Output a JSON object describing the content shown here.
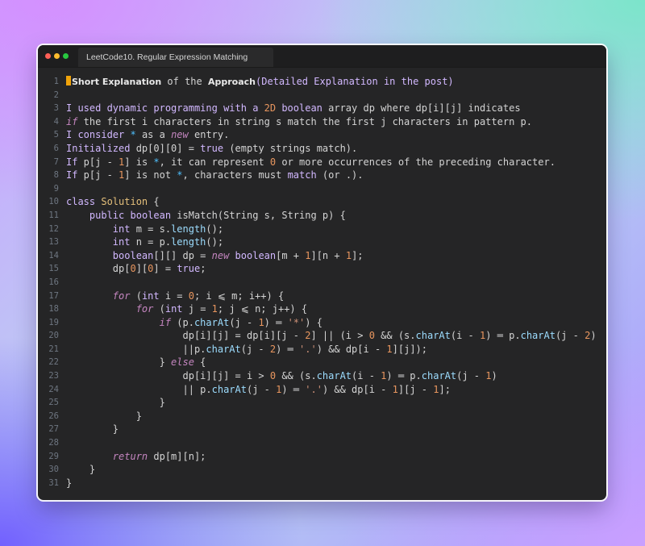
{
  "window": {
    "tab_title": "LeetCode10. Regular Expression Matching",
    "traffic_lights": [
      "#ff5f57",
      "#febc2e",
      "#28c840"
    ]
  },
  "editor": {
    "line_numbers": [
      "1",
      "2",
      "3",
      "4",
      "5",
      "6",
      "7",
      "8",
      "9",
      "10",
      "11",
      "12",
      "13",
      "14",
      "15",
      "16",
      "17",
      "18",
      "19",
      "20",
      "21",
      "22",
      "23",
      "24",
      "25",
      "26",
      "27",
      "28",
      "29",
      "30",
      "31"
    ],
    "lines": [
      [
        {
          "t": "Short Explanation",
          "c": "b"
        },
        {
          "t": " of the ",
          "c": ""
        },
        {
          "t": "Approach",
          "c": "b"
        },
        {
          "t": "(",
          "c": "c-f"
        },
        {
          "t": "Detailed Explanation",
          "c": "c-f"
        },
        {
          "t": " in the post)",
          "c": "c-f"
        }
      ],
      [],
      [
        {
          "t": "I used dynamic programming with a ",
          "c": "c-f"
        },
        {
          "t": "2D",
          "c": "c-n"
        },
        {
          "t": " ",
          "c": ""
        },
        {
          "t": "boolean",
          "c": "c-f"
        },
        {
          "t": " array dp where dp[i][j] indicates",
          "c": ""
        }
      ],
      [
        {
          "t": "if",
          "c": "c-i"
        },
        {
          "t": " the first i characters in string s match the first j characters in pattern p.",
          "c": ""
        }
      ],
      [
        {
          "t": "I consider ",
          "c": "c-f"
        },
        {
          "t": "*",
          "c": "c-b"
        },
        {
          "t": " as a ",
          "c": ""
        },
        {
          "t": "new",
          "c": "c-i"
        },
        {
          "t": " entry.",
          "c": ""
        }
      ],
      [
        {
          "t": "Initialized ",
          "c": "c-f"
        },
        {
          "t": "dp[0][0] = ",
          "c": ""
        },
        {
          "t": "true",
          "c": "c-f"
        },
        {
          "t": " (empty strings match).",
          "c": ""
        }
      ],
      [
        {
          "t": "If",
          "c": "c-f"
        },
        {
          "t": " p[j - ",
          "c": ""
        },
        {
          "t": "1",
          "c": "c-n"
        },
        {
          "t": "] is ",
          "c": ""
        },
        {
          "t": "*",
          "c": "c-b"
        },
        {
          "t": ", it can represent ",
          "c": ""
        },
        {
          "t": "0",
          "c": "c-n"
        },
        {
          "t": " or more occurrences of the preceding character.",
          "c": ""
        }
      ],
      [
        {
          "t": "If",
          "c": "c-f"
        },
        {
          "t": " p[j - ",
          "c": ""
        },
        {
          "t": "1",
          "c": "c-n"
        },
        {
          "t": "] is not ",
          "c": ""
        },
        {
          "t": "*",
          "c": "c-b"
        },
        {
          "t": ", characters must ",
          "c": ""
        },
        {
          "t": "match",
          "c": "c-f"
        },
        {
          "t": " (or .).",
          "c": ""
        }
      ],
      [],
      [
        {
          "t": "class",
          "c": "c-f"
        },
        {
          "t": " ",
          "c": ""
        },
        {
          "t": "Solution",
          "c": "c-y"
        },
        {
          "t": " {",
          "c": ""
        }
      ],
      [
        {
          "t": "    ",
          "c": ""
        },
        {
          "t": "public",
          "c": "c-f"
        },
        {
          "t": " ",
          "c": ""
        },
        {
          "t": "boolean",
          "c": "c-f"
        },
        {
          "t": " isMatch(String s, String p) {",
          "c": ""
        }
      ],
      [
        {
          "t": "        ",
          "c": ""
        },
        {
          "t": "int",
          "c": "c-f"
        },
        {
          "t": " m = s.",
          "c": ""
        },
        {
          "t": "length",
          "c": "c-m"
        },
        {
          "t": "();",
          "c": ""
        }
      ],
      [
        {
          "t": "        ",
          "c": ""
        },
        {
          "t": "int",
          "c": "c-f"
        },
        {
          "t": " n = p.",
          "c": ""
        },
        {
          "t": "length",
          "c": "c-m"
        },
        {
          "t": "();",
          "c": ""
        }
      ],
      [
        {
          "t": "        ",
          "c": ""
        },
        {
          "t": "boolean",
          "c": "c-f"
        },
        {
          "t": "[][] dp = ",
          "c": ""
        },
        {
          "t": "new",
          "c": "c-i"
        },
        {
          "t": " ",
          "c": ""
        },
        {
          "t": "boolean",
          "c": "c-f"
        },
        {
          "t": "[m + ",
          "c": ""
        },
        {
          "t": "1",
          "c": "c-n"
        },
        {
          "t": "][n + ",
          "c": ""
        },
        {
          "t": "1",
          "c": "c-n"
        },
        {
          "t": "];",
          "c": ""
        }
      ],
      [
        {
          "t": "        dp[",
          "c": ""
        },
        {
          "t": "0",
          "c": "c-n"
        },
        {
          "t": "][",
          "c": ""
        },
        {
          "t": "0",
          "c": "c-n"
        },
        {
          "t": "] = ",
          "c": ""
        },
        {
          "t": "true",
          "c": "c-f"
        },
        {
          "t": ";",
          "c": ""
        }
      ],
      [],
      [
        {
          "t": "        ",
          "c": ""
        },
        {
          "t": "for",
          "c": "c-i"
        },
        {
          "t": " (",
          "c": ""
        },
        {
          "t": "int",
          "c": "c-f"
        },
        {
          "t": " i = ",
          "c": ""
        },
        {
          "t": "0",
          "c": "c-n"
        },
        {
          "t": "; i ⩽ m; i++) {",
          "c": ""
        }
      ],
      [
        {
          "t": "            ",
          "c": ""
        },
        {
          "t": "for",
          "c": "c-i"
        },
        {
          "t": " (",
          "c": ""
        },
        {
          "t": "int",
          "c": "c-f"
        },
        {
          "t": " j = ",
          "c": ""
        },
        {
          "t": "1",
          "c": "c-n"
        },
        {
          "t": "; j ⩽ n; j++) {",
          "c": ""
        }
      ],
      [
        {
          "t": "                ",
          "c": ""
        },
        {
          "t": "if",
          "c": "c-i"
        },
        {
          "t": " (p.",
          "c": ""
        },
        {
          "t": "charAt",
          "c": "c-m"
        },
        {
          "t": "(j - ",
          "c": ""
        },
        {
          "t": "1",
          "c": "c-n"
        },
        {
          "t": ") ═ ",
          "c": ""
        },
        {
          "t": "'*'",
          "c": "c-o"
        },
        {
          "t": ") {",
          "c": ""
        }
      ],
      [
        {
          "t": "                    dp[i][j] = dp[i][j - ",
          "c": ""
        },
        {
          "t": "2",
          "c": "c-n"
        },
        {
          "t": "] || (i > ",
          "c": ""
        },
        {
          "t": "0",
          "c": "c-n"
        },
        {
          "t": " && (s.",
          "c": ""
        },
        {
          "t": "charAt",
          "c": "c-m"
        },
        {
          "t": "(i - ",
          "c": ""
        },
        {
          "t": "1",
          "c": "c-n"
        },
        {
          "t": ") ═ p.",
          "c": ""
        },
        {
          "t": "charAt",
          "c": "c-m"
        },
        {
          "t": "(j - ",
          "c": ""
        },
        {
          "t": "2",
          "c": "c-n"
        },
        {
          "t": ")",
          "c": ""
        }
      ],
      [
        {
          "t": "                    ||p.",
          "c": ""
        },
        {
          "t": "charAt",
          "c": "c-m"
        },
        {
          "t": "(j - ",
          "c": ""
        },
        {
          "t": "2",
          "c": "c-n"
        },
        {
          "t": ") ═ ",
          "c": ""
        },
        {
          "t": "'.'",
          "c": "c-o"
        },
        {
          "t": ") && dp[i - ",
          "c": ""
        },
        {
          "t": "1",
          "c": "c-n"
        },
        {
          "t": "][j]);",
          "c": ""
        }
      ],
      [
        {
          "t": "                } ",
          "c": ""
        },
        {
          "t": "else",
          "c": "c-i"
        },
        {
          "t": " {",
          "c": ""
        }
      ],
      [
        {
          "t": "                    dp[i][j] = i > ",
          "c": ""
        },
        {
          "t": "0",
          "c": "c-n"
        },
        {
          "t": " && (s.",
          "c": ""
        },
        {
          "t": "charAt",
          "c": "c-m"
        },
        {
          "t": "(i - ",
          "c": ""
        },
        {
          "t": "1",
          "c": "c-n"
        },
        {
          "t": ") ═ p.",
          "c": ""
        },
        {
          "t": "charAt",
          "c": "c-m"
        },
        {
          "t": "(j - ",
          "c": ""
        },
        {
          "t": "1",
          "c": "c-n"
        },
        {
          "t": ")",
          "c": ""
        }
      ],
      [
        {
          "t": "                    || p.",
          "c": ""
        },
        {
          "t": "charAt",
          "c": "c-m"
        },
        {
          "t": "(j - ",
          "c": ""
        },
        {
          "t": "1",
          "c": "c-n"
        },
        {
          "t": ") ═ ",
          "c": ""
        },
        {
          "t": "'.'",
          "c": "c-o"
        },
        {
          "t": ") && dp[i - ",
          "c": ""
        },
        {
          "t": "1",
          "c": "c-n"
        },
        {
          "t": "][j - ",
          "c": ""
        },
        {
          "t": "1",
          "c": "c-n"
        },
        {
          "t": "];",
          "c": ""
        }
      ],
      [
        {
          "t": "                }",
          "c": ""
        }
      ],
      [
        {
          "t": "            }",
          "c": ""
        }
      ],
      [
        {
          "t": "        }",
          "c": ""
        }
      ],
      [],
      [
        {
          "t": "        ",
          "c": ""
        },
        {
          "t": "return",
          "c": "c-i"
        },
        {
          "t": " dp[m][n];",
          "c": ""
        }
      ],
      [
        {
          "t": "    }",
          "c": ""
        }
      ],
      [
        {
          "t": "}",
          "c": ""
        }
      ]
    ]
  }
}
